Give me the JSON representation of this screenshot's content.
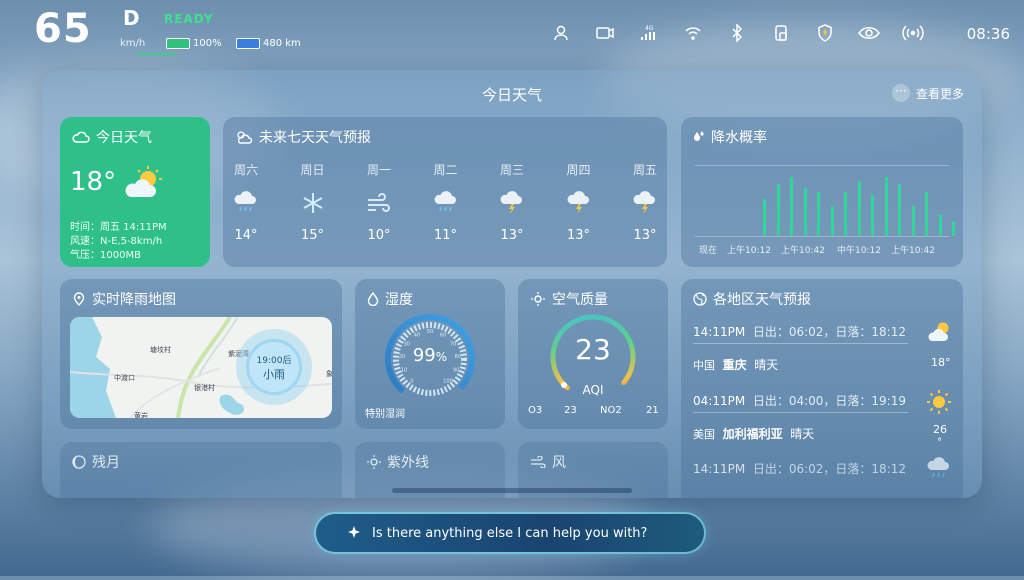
{
  "status": {
    "speed": "65",
    "gear": "D",
    "ready": "READY",
    "speed_unit": "km/h",
    "battery": "100%",
    "range": "480 km",
    "time": "08:36"
  },
  "status_icons": {
    "cell": "4G"
  },
  "panel": {
    "title": "今日天气",
    "more": "查看更多"
  },
  "today": {
    "title": "今日天气",
    "temp": "18°",
    "time": "时间：周五 14:11PM",
    "wind": "风速：N-E,5-8km/h",
    "pressure": "气压：1000MB"
  },
  "week": {
    "title": "未来七天天气预报",
    "days": [
      {
        "day": "周六",
        "icon": "rain-cloud-icon",
        "temp": "14°"
      },
      {
        "day": "周日",
        "icon": "snowflake-icon",
        "temp": "15°"
      },
      {
        "day": "周一",
        "icon": "wind-icon",
        "temp": "10°"
      },
      {
        "day": "周二",
        "icon": "rain-cloud-icon",
        "temp": "11°"
      },
      {
        "day": "周三",
        "icon": "thunder-cloud-icon",
        "temp": "13°"
      },
      {
        "day": "周四",
        "icon": "thunder-cloud-icon",
        "temp": "13°"
      },
      {
        "day": "周五",
        "icon": "thunder-cloud-icon",
        "temp": "13°"
      }
    ]
  },
  "rain": {
    "title": "降水概率",
    "labels": [
      "现在",
      "上午10:12",
      "上午10:42",
      "中午10:12",
      "上午10:42"
    ]
  },
  "chart_data": {
    "type": "bar",
    "values": [
      0.5,
      0.7,
      0.8,
      0.65,
      0.6,
      0.4,
      0.6,
      0.75,
      0.55,
      0.8,
      0.7,
      0.4,
      0.6,
      0.3,
      0.2
    ],
    "ylim": [
      0,
      1
    ]
  },
  "radar": {
    "title": "实时降雨地图",
    "badge_time": "19:00后",
    "badge_text": "小雨",
    "places": [
      "塘坟村",
      "紫泥湾",
      "中渡口",
      "银港村",
      "黄岩",
      "象"
    ]
  },
  "humidity": {
    "title": "湿度",
    "value": "99",
    "unit": "%",
    "label": "特别湿润",
    "ticks": [
      "0",
      "10",
      "20",
      "30",
      "40",
      "50",
      "60",
      "70",
      "80",
      "90",
      "100"
    ]
  },
  "air": {
    "title": "空气质量",
    "value": "23",
    "label": "AQI",
    "o3_label": "O3",
    "o3": "23",
    "no2_label": "NO2",
    "no2": "21"
  },
  "regions": {
    "title": "各地区天气预报",
    "items": [
      {
        "time": "14:11PM",
        "sun": "日出：06:02，日落：18:12",
        "country": "中国",
        "city": "重庆",
        "cond": "晴天",
        "temp": "18°"
      },
      {
        "time": "04:11PM",
        "sun": "日出：04:00，日落：19:19",
        "country": "美国",
        "city": "加利福利亚",
        "cond": "晴天",
        "temp": "26",
        "unit": "°"
      },
      {
        "time": "14:11PM",
        "sun": "日出：06:02，日落：18:12"
      }
    ]
  },
  "moon": {
    "title": "残月"
  },
  "uv": {
    "title": "紫外线"
  },
  "wind": {
    "title": "风"
  },
  "assistant": {
    "prompt": "Is there anything else I can help you with?"
  }
}
